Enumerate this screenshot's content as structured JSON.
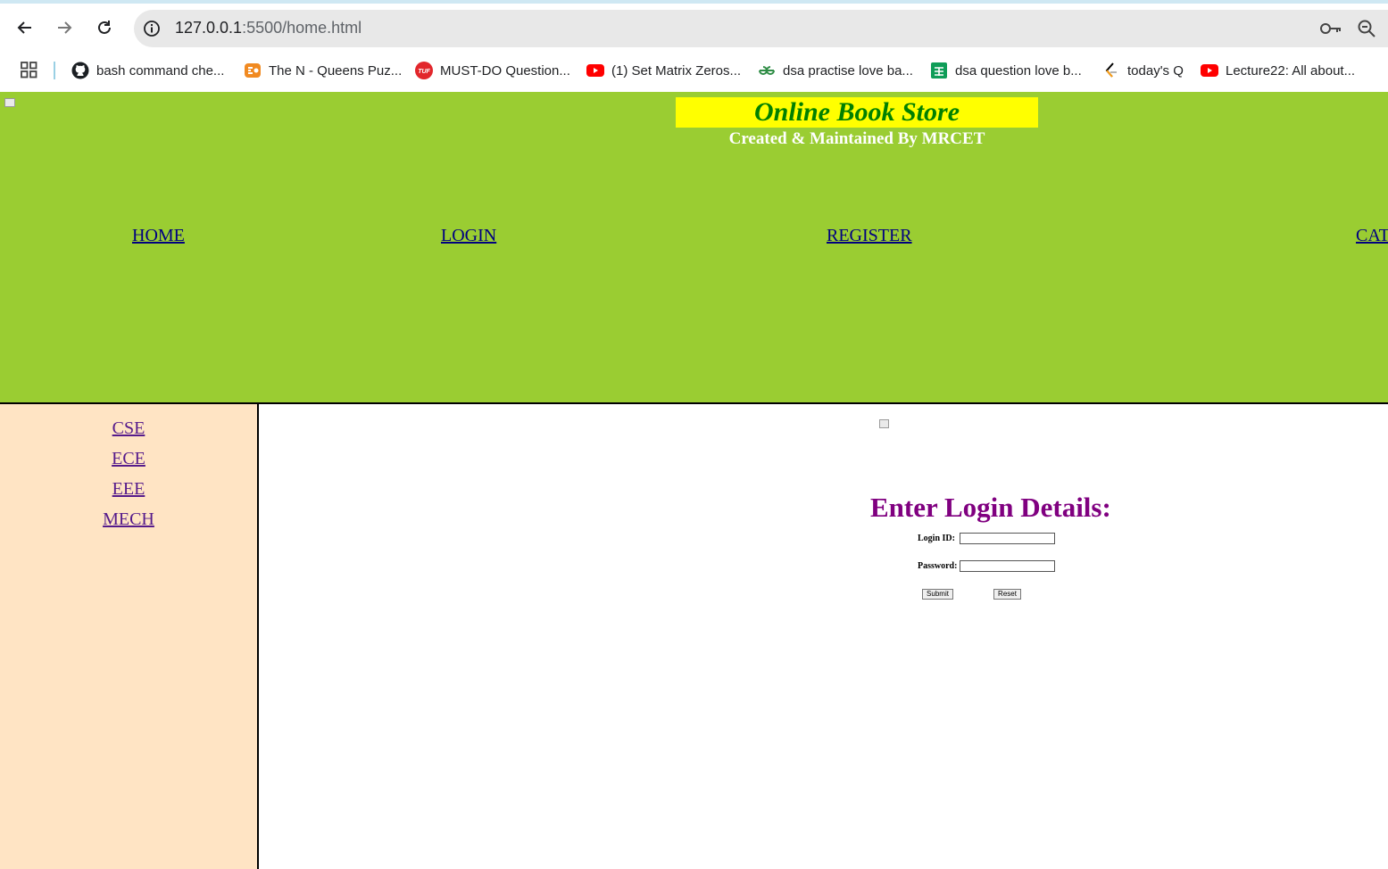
{
  "browser": {
    "url_host": "127.0.0.1",
    "url_rest": ":5500/home.html",
    "bookmarks": [
      {
        "label": "bash command che...",
        "icon": "github-icon"
      },
      {
        "label": "The N - Queens Puz...",
        "icon": "codestudio-icon"
      },
      {
        "label": "MUST-DO Question...",
        "icon": "tuf-icon"
      },
      {
        "label": "(1) Set Matrix Zeros...",
        "icon": "youtube-icon"
      },
      {
        "label": "dsa practise love ba...",
        "icon": "geeksforgeeks-icon"
      },
      {
        "label": "dsa question love b...",
        "icon": "sheets-icon"
      },
      {
        "label": "today's Q",
        "icon": "leetcode-icon"
      },
      {
        "label": "Lecture22: All about...",
        "icon": "youtube-icon"
      }
    ]
  },
  "header": {
    "title": "Online Book Store",
    "subtitle": "Created & Maintained By MRCET",
    "nav": [
      {
        "label": "HOME"
      },
      {
        "label": "LOGIN"
      },
      {
        "label": "REGISTER"
      },
      {
        "label": "CAT"
      }
    ]
  },
  "sidebar": {
    "links": [
      {
        "label": "CSE"
      },
      {
        "label": "ECE"
      },
      {
        "label": "EEE"
      },
      {
        "label": "MECH"
      }
    ]
  },
  "login": {
    "heading": "Enter Login Details:",
    "id_label": "Login ID:",
    "id_value": "",
    "password_label": "Password:",
    "password_value": "",
    "submit_label": "Submit",
    "reset_label": "Reset"
  },
  "colors": {
    "header_bg": "#9acd32",
    "title_bg": "#ffff00",
    "title_text": "#008000",
    "sidebar_bg": "#ffe4c4",
    "login_heading": "#800080"
  }
}
